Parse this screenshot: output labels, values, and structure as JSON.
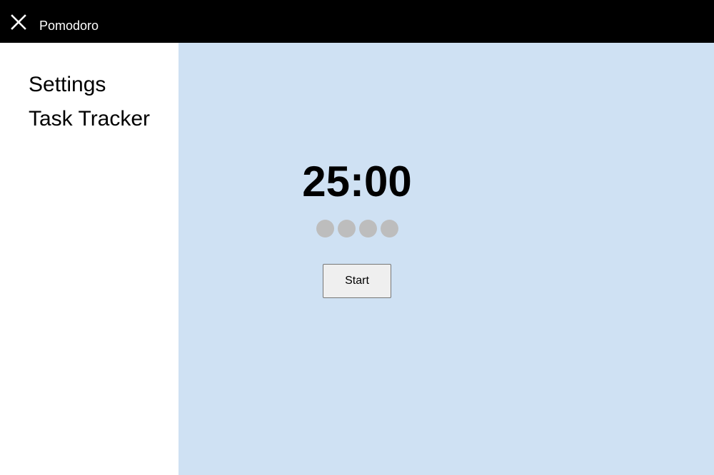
{
  "header": {
    "close_icon": "close-icon",
    "title": "Pomodoro"
  },
  "sidebar": {
    "items": [
      {
        "label": "Settings"
      },
      {
        "label": "Task Tracker"
      }
    ]
  },
  "main": {
    "timer": "25:00",
    "session_dots": {
      "total": 4,
      "completed": 0
    },
    "start_label": "Start"
  },
  "colors": {
    "header_bg": "#000000",
    "main_bg": "#cfe1f3",
    "sidebar_bg": "#ffffff",
    "dot_inactive": "#bdbdbd"
  }
}
